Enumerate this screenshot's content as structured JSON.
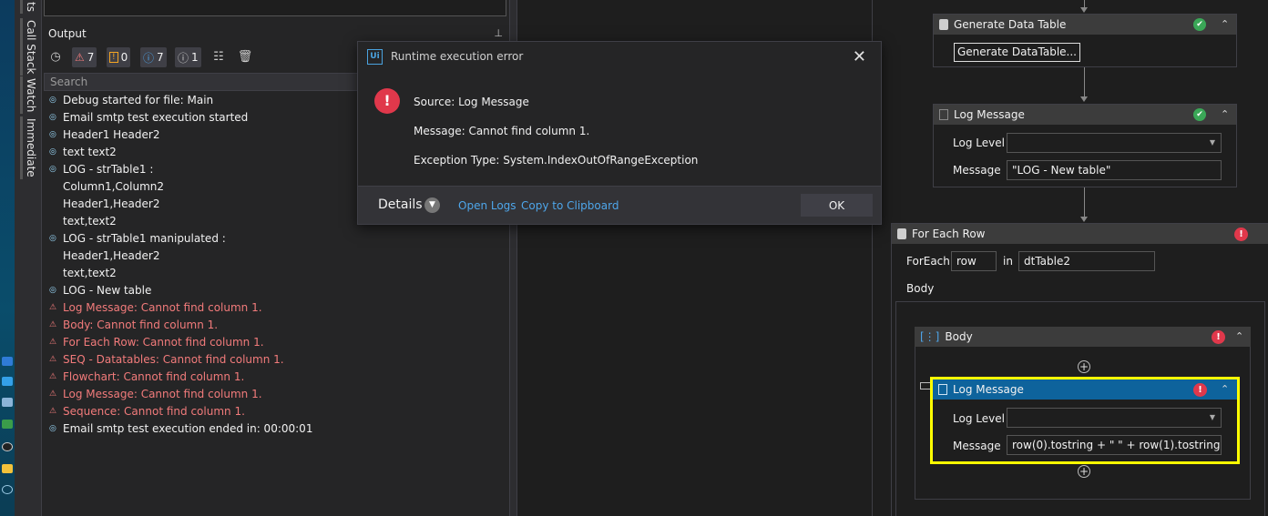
{
  "vtabs": [
    "ts",
    "Call Stack",
    "Watch",
    "Immediate"
  ],
  "output": {
    "title": "Output",
    "pin_glyph": "⊥",
    "toolbar": {
      "errors_count": "7",
      "warnings_count": "0",
      "info_count": "7",
      "trace_count": "1"
    },
    "search_placeholder": "Search",
    "lines": [
      {
        "type": "info",
        "text": "Debug started for file: Main"
      },
      {
        "type": "info",
        "text": "Email smtp test execution started"
      },
      {
        "type": "info",
        "text": "Header1 Header2"
      },
      {
        "type": "info",
        "text": "text text2"
      },
      {
        "type": "info",
        "text": "LOG - strTable1 :"
      },
      {
        "type": "cont",
        "text": "Column1,Column2"
      },
      {
        "type": "cont",
        "text": "Header1,Header2"
      },
      {
        "type": "cont",
        "text": "text,text2"
      },
      {
        "type": "info",
        "text": "LOG - strTable1 manipulated :"
      },
      {
        "type": "cont",
        "text": "Header1,Header2"
      },
      {
        "type": "cont",
        "text": "text,text2"
      },
      {
        "type": "info",
        "text": "LOG - New table"
      },
      {
        "type": "error",
        "text": "Log Message: Cannot find column 1."
      },
      {
        "type": "error",
        "text": "Body: Cannot find column 1."
      },
      {
        "type": "error",
        "text": "For Each Row: Cannot find column 1."
      },
      {
        "type": "error",
        "text": "SEQ - Datatables: Cannot find column 1."
      },
      {
        "type": "error",
        "text": "Flowchart: Cannot find column 1."
      },
      {
        "type": "error",
        "text": "Log Message: Cannot find column 1."
      },
      {
        "type": "error",
        "text": "Sequence: Cannot find column 1."
      },
      {
        "type": "info",
        "text": "Email smtp test execution ended in: 00:00:01"
      }
    ]
  },
  "dialog": {
    "logo": "Ui",
    "title": "Runtime execution error",
    "source": "Source: Log Message",
    "message": "Message: Cannot find column 1.",
    "exception": "Exception Type: System.IndexOutOfRangeException",
    "details_label": "Details",
    "open_logs": "Open Logs",
    "copy_clipboard": "Copy to Clipboard",
    "ok": "OK"
  },
  "designer": {
    "generate_dt": {
      "title": "Generate Data Table",
      "button": "Generate DataTable..."
    },
    "log1": {
      "title": "Log Message",
      "level_label": "Log Level",
      "message_label": "Message",
      "message_value": "\"LOG - New table\""
    },
    "foreach": {
      "title": "For Each Row",
      "foreach_label": "ForEach",
      "var_value": "row",
      "in_label": "in",
      "collection_value": "dtTable2",
      "body_label": "Body"
    },
    "body": {
      "title": "Body"
    },
    "log2": {
      "title": "Log Message",
      "level_label": "Log Level",
      "message_label": "Message",
      "message_value": "row(0).tostring + \" \" + row(1).tostring"
    }
  },
  "colors": {
    "error": "#e0384b",
    "ok": "#3aa757",
    "link": "#4ea6ea",
    "highlight": "#ffff00",
    "selected": "#0e639c"
  }
}
